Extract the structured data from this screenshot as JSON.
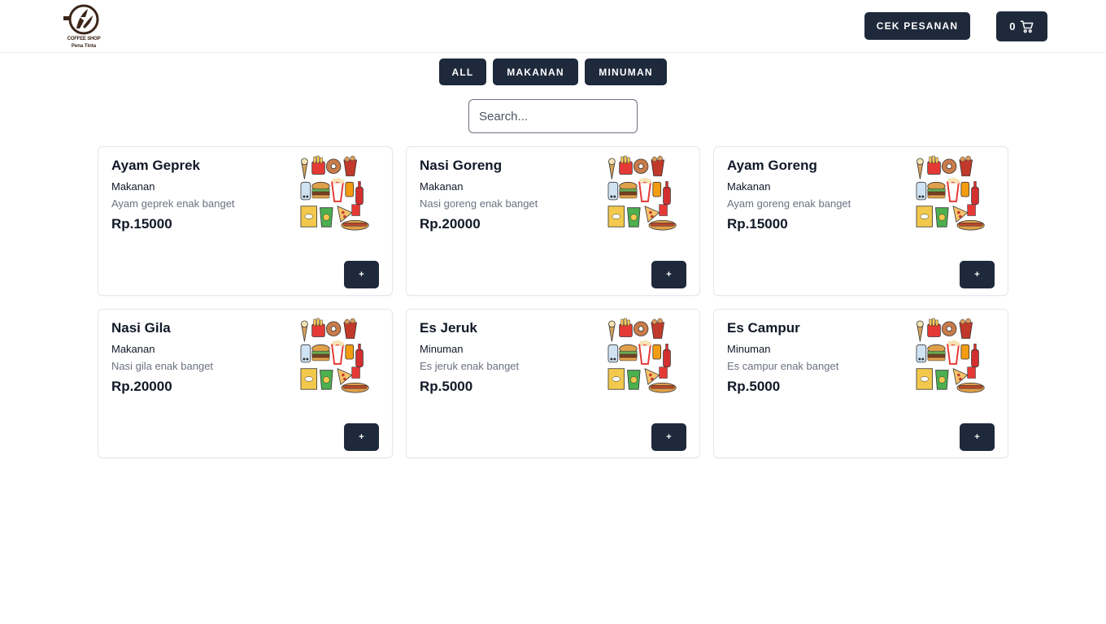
{
  "header": {
    "logo_text_line1": "COFFEE SHOP",
    "logo_text_line2": "Pena Tinta",
    "cek_pesanan_label": "CEK PESANAN",
    "cart_count": "0"
  },
  "filters": {
    "all_label": "ALL",
    "makanan_label": "MAKANAN",
    "minuman_label": "MINUMAN"
  },
  "search": {
    "placeholder": "Search..."
  },
  "products": [
    {
      "name": "Ayam Geprek",
      "category": "Makanan",
      "description": "Ayam geprek enak banget",
      "price": "Rp.15000",
      "add_label": "+"
    },
    {
      "name": "Nasi Goreng",
      "category": "Makanan",
      "description": "Nasi goreng enak banget",
      "price": "Rp.20000",
      "add_label": "+"
    },
    {
      "name": "Ayam Goreng",
      "category": "Makanan",
      "description": "Ayam goreng enak banget",
      "price": "Rp.15000",
      "add_label": "+"
    },
    {
      "name": "Nasi Gila",
      "category": "Makanan",
      "description": "Nasi gila enak banget",
      "price": "Rp.20000",
      "add_label": "+"
    },
    {
      "name": "Es Jeruk",
      "category": "Minuman",
      "description": "Es jeruk enak banget",
      "price": "Rp.5000",
      "add_label": "+"
    },
    {
      "name": "Es Campur",
      "category": "Minuman",
      "description": "Es campur enak banget",
      "price": "Rp.5000",
      "add_label": "+"
    }
  ],
  "colors": {
    "primary_dark": "#1e293b",
    "logo_brown": "#3b2418"
  }
}
